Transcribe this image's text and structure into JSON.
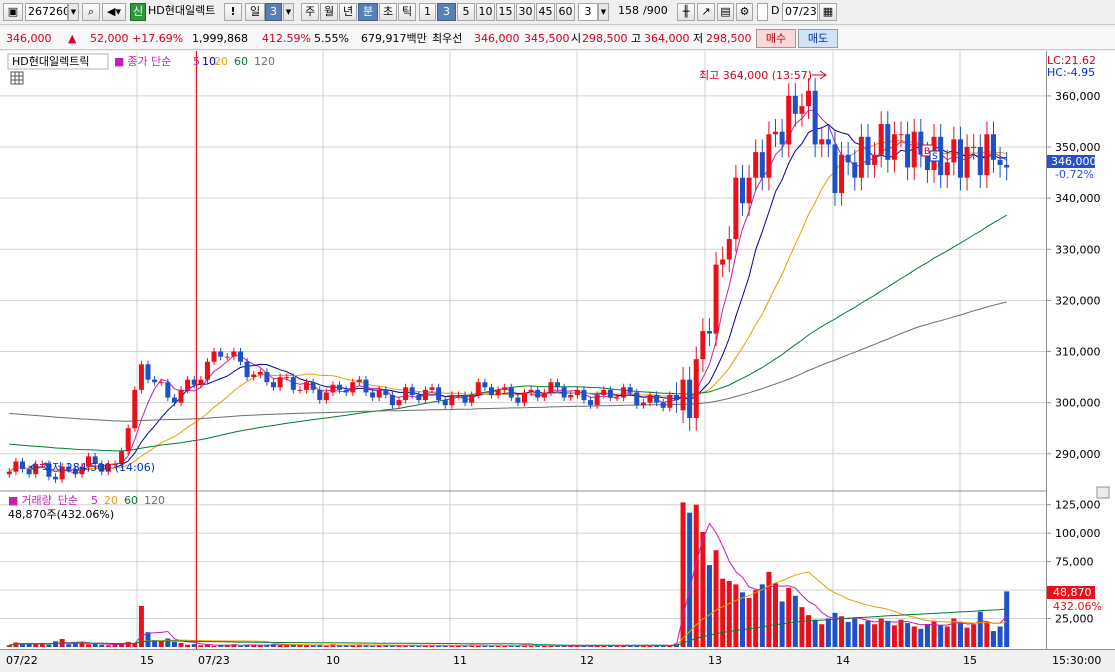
{
  "toolbar": {
    "code": "267260",
    "name": "HD현대일렉트",
    "badge": "신",
    "warn": "!",
    "day_label": "일",
    "day_count": "3",
    "week": "주",
    "month": "월",
    "year": "년",
    "minute": "분",
    "second": "초",
    "tick": "틱",
    "intervals": [
      "1",
      "3",
      "5",
      "10",
      "15",
      "30",
      "45",
      "60"
    ],
    "interval_input": "3",
    "count": "158",
    "count_total": "/900",
    "date_check": "D",
    "date": "07/23"
  },
  "quote": {
    "price": "346,000",
    "arrow": "▲",
    "change": "52,000",
    "pct": "+17.69%",
    "volume": "1,999,868",
    "vol_ratio": "412.59%",
    "turnover": "5.55%",
    "amount": "679,917백만",
    "best_label": "최우선",
    "ask": "346,000",
    "bid": "345,500",
    "open_label": "시",
    "open": "298,500",
    "high_label": "고",
    "high": "364,000",
    "low_label": "저",
    "low": "298,500",
    "buy": "매수",
    "sell": "매도"
  },
  "legend": {
    "stock": "HD현대일렉트릭",
    "ma_label": "종가 단순",
    "ma": [
      "5",
      "10",
      "20",
      "60",
      "120"
    ],
    "vol_label": "거래량",
    "vol_ma_label": "단순",
    "vol_ma": [
      "5",
      "20",
      "60",
      "120"
    ],
    "vol_info": "48,870주(432.06%)",
    "lc": "LC:21.62",
    "hc": "HC:-4.95",
    "price_tag": "346,000",
    "price_pct": "-0.72%",
    "vol_tag": "48,870",
    "vol_pct": "432.06%",
    "high_note": "최고 364,000 (13:57)",
    "low_note": "최저 284,500 (14:06)"
  },
  "colors": {
    "up": "#e8101a",
    "down": "#1e50c8",
    "ma5": "#c81eb4",
    "ma10": "#000096",
    "ma20": "#e6a000",
    "ma60": "#007d32",
    "ma120": "#6e6e6e",
    "grid": "#d2d2d2"
  },
  "chart_data": {
    "type": "candlestick",
    "ylim": [
      283500,
      368000
    ],
    "y_ticks": [
      "360,000",
      "350,000",
      "340,000",
      "330,000",
      "320,000",
      "310,000",
      "300,000",
      "290,000"
    ],
    "vol_ylim": [
      0,
      130000
    ],
    "vol_ticks": [
      "125,000",
      "100,000",
      "75,000",
      "50,000",
      "25,000"
    ],
    "x_labels": [
      "07/22",
      "15",
      "07/23",
      "10",
      "11",
      "12",
      "13",
      "14",
      "15",
      "15:30:00"
    ],
    "keys": [
      {
        "t": "07/22",
        "v": 286500
      },
      {
        "t": "15",
        "v": 287500
      },
      {
        "t": "07/23",
        "v": 306500
      },
      {
        "t": "07/23",
        "v": 300500
      },
      {
        "t": "07/23",
        "v": 309500
      },
      {
        "t": "10",
        "v": 303000
      },
      {
        "t": "10",
        "v": 302500
      },
      {
        "t": "11",
        "v": 301000
      },
      {
        "t": "11",
        "v": 302000
      },
      {
        "t": "12",
        "v": 302000
      },
      {
        "t": "12",
        "v": 301000
      },
      {
        "t": "13",
        "v": 301000
      },
      {
        "t": "13",
        "v": 301000
      },
      {
        "t": "13",
        "v": 340000
      },
      {
        "t": "13",
        "v": 360000
      },
      {
        "t": "14",
        "v": 345000
      },
      {
        "t": "14",
        "v": 348000
      },
      {
        "t": "14",
        "v": 351500
      },
      {
        "t": "15",
        "v": 347500
      },
      {
        "t": "15",
        "v": 349000
      },
      {
        "t": "15",
        "v": 346000
      }
    ],
    "volumes": [
      1500,
      4000,
      3000,
      3500,
      2500,
      3000,
      2000,
      5000,
      7000,
      2500,
      4000,
      3500,
      2500,
      3000,
      2000,
      1500,
      2500,
      3000,
      4500,
      3500,
      36000,
      13000,
      6000,
      5500,
      7500,
      4500,
      3500,
      2000,
      2500,
      1500,
      2000,
      1000,
      1500,
      2000,
      2500,
      1000,
      2000,
      1500,
      1500,
      2000,
      2500,
      1500,
      1500,
      2500,
      2000,
      1500,
      1500,
      2000,
      1000,
      2500,
      1500,
      2000,
      1500,
      2000,
      1500,
      1000,
      1500,
      1500,
      1000,
      1200,
      1500,
      2000,
      1000,
      1500,
      1200,
      1000,
      1300,
      1500,
      1500,
      1000,
      2000,
      1500,
      1200,
      1000,
      1500,
      1200,
      1800,
      1300,
      2000,
      1000,
      1500,
      1200,
      1000,
      1500,
      1000,
      1200,
      1000,
      1500,
      1000,
      1800,
      1200,
      1000,
      1500,
      1000,
      1500,
      1800,
      1200,
      1300,
      1800,
      1000,
      1500,
      3000,
      127000,
      118000,
      125000,
      101000,
      72000,
      85000,
      60000,
      58000,
      55000,
      48000,
      43000,
      50000,
      55000,
      66000,
      56000,
      40000,
      52000,
      45000,
      35000,
      28000,
      24000,
      20000,
      25000,
      30000,
      27000,
      22000,
      25000,
      20000,
      23000,
      20000,
      25000,
      23000,
      19000,
      24000,
      21000,
      18000,
      16000,
      20000,
      23000,
      19000,
      18000,
      25000,
      22000,
      17000,
      20000,
      31000,
      22000,
      14000,
      18000,
      48870
    ]
  }
}
